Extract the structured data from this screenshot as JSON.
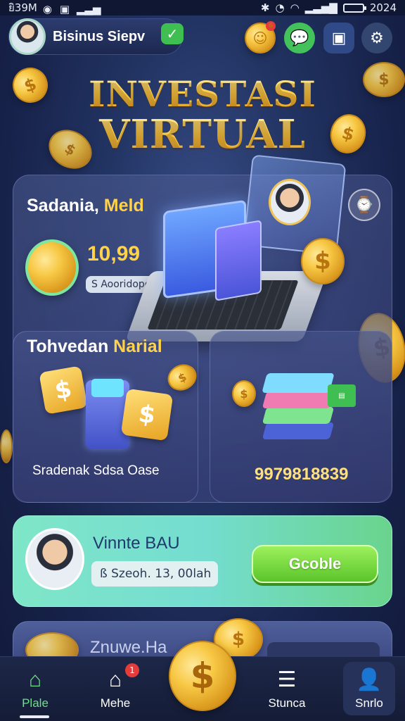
{
  "status_bar": {
    "left_text": "ยิ39M",
    "right_text": "2024"
  },
  "profile": {
    "name": "Bisinus Siepv"
  },
  "top_icons": {
    "coin_badge_count": "",
    "message_icon": "chat-icon",
    "bag_icon": "bag-icon",
    "settings_icon": "gear-icon"
  },
  "title": {
    "line1": "INVESTASI",
    "line2": "VIRTUAL"
  },
  "panel": {
    "section1_heading_white": "Sadania,",
    "section1_heading_gold": "Meld",
    "section1_value": "10,99",
    "section1_chip": "S Aooridopo",
    "section2_heading_white": "Tohvedan",
    "section2_heading_gold": "Narial",
    "section2_caption": "Sradenak Sdsa Oase",
    "section3_value": "9979818839"
  },
  "reward": {
    "title": "Vinnte BAU",
    "chip_text": "ß Szeoh. 13, 00lah",
    "button_label": "Gcoble"
  },
  "partial_card": {
    "text": "Znuwe.Ha"
  },
  "nav": {
    "items": [
      {
        "label": "Plale",
        "icon": "home-icon"
      },
      {
        "label": "Mehe",
        "icon": "house-icon",
        "badge": "1"
      },
      {
        "label": "",
        "icon": "coin-icon"
      },
      {
        "label": "Stunca",
        "icon": "list-icon"
      },
      {
        "label": "Snrlo",
        "icon": "user-icon"
      }
    ]
  },
  "colors": {
    "accent_gold": "#ffd24a",
    "accent_green": "#5bc52b",
    "background": "#1c2a55"
  }
}
